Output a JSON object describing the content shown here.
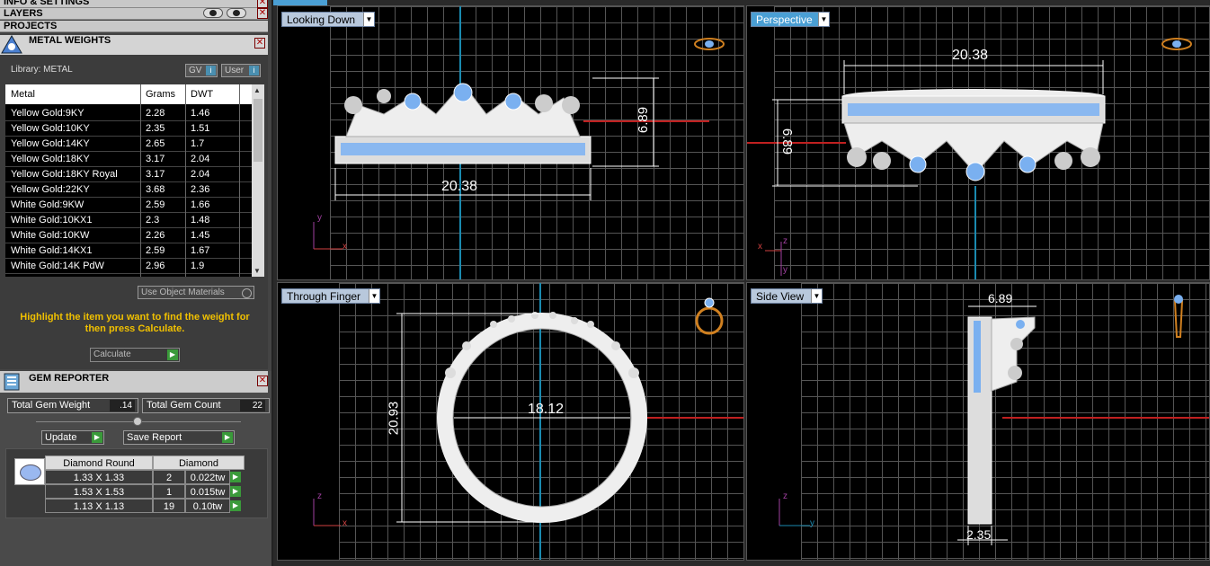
{
  "panels": {
    "info_settings": "INFO & SETTINGS",
    "layers": "LAYERS",
    "projects": "PROJECTS"
  },
  "metal": {
    "title": "METAL WEIGHTS",
    "library_label": "Library: METAL",
    "gv_label": "GV",
    "user_label": "User",
    "columns": [
      "Metal",
      "Grams",
      "DWT"
    ],
    "rows": [
      {
        "metal": "Yellow Gold:9KY",
        "grams": "2.28",
        "dwt": "1.46"
      },
      {
        "metal": "Yellow Gold:10KY",
        "grams": "2.35",
        "dwt": "1.51"
      },
      {
        "metal": "Yellow Gold:14KY",
        "grams": "2.65",
        "dwt": "1.7"
      },
      {
        "metal": "Yellow Gold:18KY",
        "grams": "3.17",
        "dwt": "2.04"
      },
      {
        "metal": "Yellow Gold:18KY Royal",
        "grams": "3.17",
        "dwt": "2.04"
      },
      {
        "metal": "Yellow Gold:22KY",
        "grams": "3.68",
        "dwt": "2.36"
      },
      {
        "metal": "White Gold:9KW",
        "grams": "2.59",
        "dwt": "1.66"
      },
      {
        "metal": "White Gold:10KX1",
        "grams": "2.3",
        "dwt": "1.48"
      },
      {
        "metal": "White Gold:10KW",
        "grams": "2.26",
        "dwt": "1.45"
      },
      {
        "metal": "White Gold:14KX1",
        "grams": "2.59",
        "dwt": "1.67"
      },
      {
        "metal": "White Gold:14K PdW",
        "grams": "2.96",
        "dwt": "1.9"
      }
    ],
    "use_object_materials": "Use Object Materials",
    "hint": "Highlight the item you want to find the weight for then press Calculate.",
    "calculate": "Calculate"
  },
  "gem": {
    "title": "GEM REPORTER",
    "total_weight_label": "Total Gem Weight",
    "total_weight": ".14",
    "total_count_label": "Total Gem Count",
    "total_count": "22",
    "update": "Update",
    "save_report": "Save Report",
    "col_shape": "Diamond Round",
    "col_type": "Diamond",
    "rows": [
      {
        "size": "1.33 X 1.33",
        "count": "2",
        "tw": "0.022tw"
      },
      {
        "size": "1.53 X 1.53",
        "count": "1",
        "tw": "0.015tw"
      },
      {
        "size": "1.13 X 1.13",
        "count": "19",
        "tw": "0.10tw"
      }
    ]
  },
  "viewports": {
    "top_left": {
      "label": "Looking Down",
      "width_dim": "20.38",
      "height_dim": "6.89",
      "axis_y": "y",
      "axis_x": "x"
    },
    "top_right": {
      "label": "Perspective",
      "width_dim": "20.38",
      "height_dim": "6.89",
      "axis_z": "z",
      "axis_x": "x",
      "axis_y": "y"
    },
    "bottom_left": {
      "label": "Through Finger",
      "inner_dim": "18.12",
      "height_dim": "20.93",
      "axis_z": "z",
      "axis_x": "x"
    },
    "bottom_right": {
      "label": "Side View",
      "width_dim": "6.89",
      "bottom_dim": "2.35",
      "axis_z": "z",
      "axis_y": "y"
    }
  }
}
